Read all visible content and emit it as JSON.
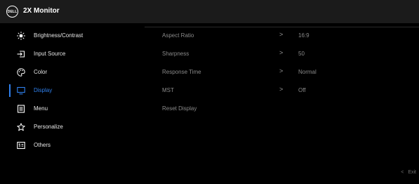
{
  "header": {
    "logo_text": "DELL",
    "title": "2X Monitor"
  },
  "menu": {
    "items": [
      {
        "label": "Brightness/Contrast",
        "icon": "brightness-icon"
      },
      {
        "label": "Input Source",
        "icon": "input-source-icon"
      },
      {
        "label": "Color",
        "icon": "color-palette-icon"
      },
      {
        "label": "Display",
        "icon": "display-monitor-icon",
        "active": true
      },
      {
        "label": "Menu",
        "icon": "menu-list-icon"
      },
      {
        "label": "Personalize",
        "icon": "star-icon"
      },
      {
        "label": "Others",
        "icon": "others-icon"
      }
    ]
  },
  "options": [
    {
      "label": "Aspect Ratio",
      "chevron": ">",
      "value": "16:9"
    },
    {
      "label": "Sharpness",
      "chevron": ">",
      "value": "50"
    },
    {
      "label": "Response Time",
      "chevron": ">",
      "value": "Normal"
    },
    {
      "label": "MST",
      "chevron": ">",
      "value": "Off"
    },
    {
      "label": "Reset Display",
      "chevron": "",
      "value": ""
    }
  ],
  "footer": {
    "exit_chevron": "<",
    "exit_label": "Exit"
  },
  "colors": {
    "accent": "#2f80ed",
    "background": "#000000",
    "header": "#1b1b1b"
  }
}
